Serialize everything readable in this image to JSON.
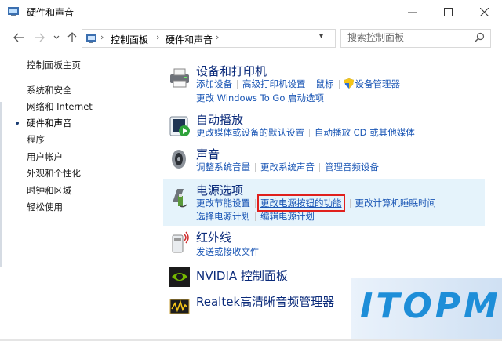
{
  "window": {
    "title": "硬件和声音"
  },
  "navigation": {
    "breadcrumb": [
      "控制面板",
      "硬件和声音"
    ],
    "search_placeholder": "搜索控制面板"
  },
  "sidebar": {
    "items": [
      {
        "label": "控制面板主页",
        "active": false
      },
      {
        "label": "系统和安全",
        "active": false
      },
      {
        "label": "网络和 Internet",
        "active": false
      },
      {
        "label": "硬件和声音",
        "active": true
      },
      {
        "label": "程序",
        "active": false
      },
      {
        "label": "用户帐户",
        "active": false
      },
      {
        "label": "外观和个性化",
        "active": false
      },
      {
        "label": "时钟和区域",
        "active": false
      },
      {
        "label": "轻松使用",
        "active": false
      }
    ]
  },
  "categories": [
    {
      "title": "设备和打印机",
      "icon": "printer-icon",
      "line1": [
        "添加设备",
        "高级打印机设置",
        "鼠标",
        "设备管理器"
      ],
      "line2": [
        "更改 Windows To Go 启动选项"
      ]
    },
    {
      "title": "自动播放",
      "icon": "autoplay-icon",
      "line1": [
        "更改媒体或设备的默认设置",
        "自动播放 CD 或其他媒体"
      ]
    },
    {
      "title": "声音",
      "icon": "speaker-icon",
      "line1": [
        "调整系统音量",
        "更改系统声音",
        "管理音频设备"
      ]
    },
    {
      "title": "电源选项",
      "icon": "power-icon",
      "highlighted": true,
      "line1": [
        "更改节能设置",
        "更改电源按钮的功能",
        "更改计算机睡眠时间"
      ],
      "line2": [
        "选择电源计划",
        "编辑电源计划"
      ],
      "boxed_link": "更改电源按钮的功能"
    },
    {
      "title": "红外线",
      "icon": "infrared-icon",
      "line1": [
        "发送或接收文件"
      ]
    },
    {
      "title": "NVIDIA 控制面板",
      "icon": "nvidia-icon"
    },
    {
      "title": "Realtek高清晰音频管理器",
      "icon": "realtek-icon"
    }
  ],
  "watermark": "ITOPM",
  "colors": {
    "link": "#1a56b5",
    "category_title": "#0a2a7a",
    "highlight_bg": "#e5f3fb",
    "callout_box": "#e0201d"
  }
}
